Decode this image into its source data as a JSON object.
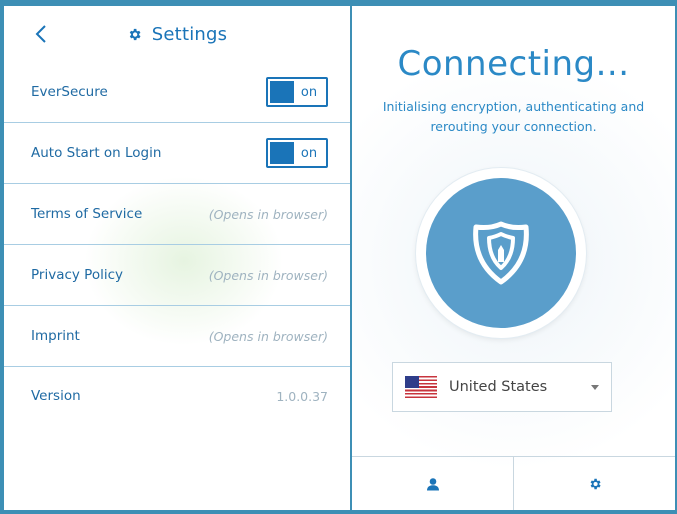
{
  "settings": {
    "title": "Settings",
    "back_icon": "chevron-left-icon",
    "title_icon": "gear-icon",
    "rows": [
      {
        "label": "EverSecure",
        "kind": "toggle",
        "toggle_text": "on"
      },
      {
        "label": "Auto Start on Login",
        "kind": "toggle",
        "toggle_text": "on"
      },
      {
        "label": "Terms of Service",
        "kind": "link",
        "hint": "(Opens in browser)"
      },
      {
        "label": "Privacy Policy",
        "kind": "link",
        "hint": "(Opens in browser)"
      },
      {
        "label": "Imprint",
        "kind": "link",
        "hint": "(Opens in browser)"
      },
      {
        "label": "Version",
        "kind": "value",
        "value": "1.0.0.37"
      }
    ]
  },
  "connect": {
    "title": "Connecting...",
    "subtitle": "Initialising encryption, authenticating and rerouting your connection.",
    "power_icon": "shield-icon",
    "country": {
      "name": "United States",
      "flag": "us-flag-icon"
    },
    "bottom": {
      "left_icon": "user-icon",
      "right_icon": "gear-icon"
    }
  },
  "colors": {
    "accent": "#1a74b8",
    "power_button": "#5a9ecb",
    "background": "#3d8fb5"
  }
}
